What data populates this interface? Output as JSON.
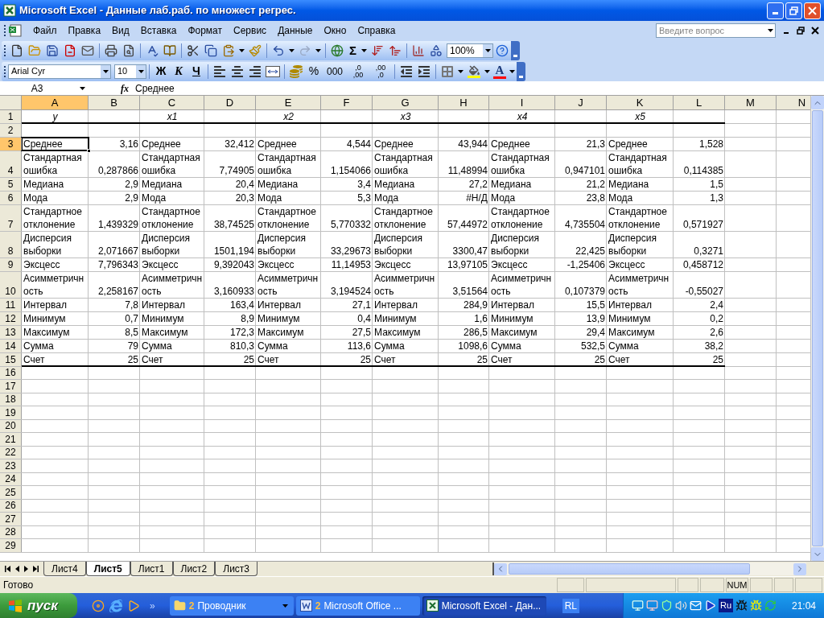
{
  "window": {
    "title": "Microsoft Excel - Данные лаб.раб. по множест регрес."
  },
  "menu": [
    "Файл",
    "Правка",
    "Вид",
    "Вставка",
    "Формат",
    "Сервис",
    "Данные",
    "Окно",
    "Справка"
  ],
  "help_search": {
    "placeholder": "Введите вопрос"
  },
  "standard_toolbar": {
    "sum": "Σ",
    "zoom": "100%"
  },
  "format_toolbar": {
    "font": "Arial Cyr",
    "size": "10",
    "bold": "Ж",
    "italic": "К",
    "underline": "Ч",
    "percent": "%",
    "thousands": "000",
    "increase_decimal": {
      "top": ",0",
      "bottom": ",00"
    },
    "decrease_decimal": {
      "top": ",00",
      "bottom": ",0"
    },
    "font_color": "A"
  },
  "formula_bar": {
    "name_box": "A3",
    "fx": "fx",
    "formula": "Среднее"
  },
  "columns": [
    {
      "label": "A",
      "selected": true
    },
    {
      "label": "B",
      "selected": false
    },
    {
      "label": "C",
      "selected": false
    },
    {
      "label": "D",
      "selected": false
    },
    {
      "label": "E",
      "selected": false
    },
    {
      "label": "F",
      "selected": false
    },
    {
      "label": "G",
      "selected": false
    },
    {
      "label": "H",
      "selected": false
    },
    {
      "label": "I",
      "selected": false
    },
    {
      "label": "J",
      "selected": false
    },
    {
      "label": "K",
      "selected": false
    },
    {
      "label": "L",
      "selected": false
    },
    {
      "label": "M",
      "selected": false
    },
    {
      "label": "N",
      "selected": false
    }
  ],
  "rows": [
    {
      "number": "1",
      "kind": "header",
      "selected": false,
      "labels": [
        "y",
        "x1",
        "x2",
        "x3",
        "x4",
        "x5"
      ]
    },
    {
      "number": "2",
      "kind": "blank",
      "selected": false
    },
    {
      "number": "3",
      "kind": "stats",
      "selected": true,
      "pairs": [
        {
          "label": "Среднее",
          "value": "3,16"
        },
        {
          "label": "Среднее",
          "value": "32,412"
        },
        {
          "label": "Среднее",
          "value": "4,544"
        },
        {
          "label": "Среднее",
          "value": "43,944"
        },
        {
          "label": "Среднее",
          "value": "21,3"
        },
        {
          "label": "Среднее",
          "value": "1,528"
        }
      ]
    },
    {
      "number": "4",
      "kind": "stats",
      "selected": false,
      "pairs": [
        {
          "label": "Стандартная ошибка",
          "value": "0,287866"
        },
        {
          "label": "Стандартная ошибка",
          "value": "7,74905"
        },
        {
          "label": "Стандартная ошибка",
          "value": "1,154066"
        },
        {
          "label": "Стандартная ошибка",
          "value": "11,48994"
        },
        {
          "label": "Стандартная ошибка",
          "value": "0,947101"
        },
        {
          "label": "Стандартная ошибка",
          "value": "0,114385"
        }
      ]
    },
    {
      "number": "5",
      "kind": "stats",
      "selected": false,
      "pairs": [
        {
          "label": "Медиана",
          "value": "2,9"
        },
        {
          "label": "Медиана",
          "value": "20,4"
        },
        {
          "label": "Медиана",
          "value": "3,4"
        },
        {
          "label": "Медиана",
          "value": "27,2"
        },
        {
          "label": "Медиана",
          "value": "21,2"
        },
        {
          "label": "Медиана",
          "value": "1,5"
        }
      ]
    },
    {
      "number": "6",
      "kind": "stats",
      "selected": false,
      "pairs": [
        {
          "label": "Мода",
          "value": "2,9"
        },
        {
          "label": "Мода",
          "value": "20,3"
        },
        {
          "label": "Мода",
          "value": "5,3"
        },
        {
          "label": "Мода",
          "value": "#Н/Д"
        },
        {
          "label": "Мода",
          "value": "23,8"
        },
        {
          "label": "Мода",
          "value": "1,3"
        }
      ]
    },
    {
      "number": "7",
      "kind": "stats",
      "selected": false,
      "pairs": [
        {
          "label": "Стандартное отклонение",
          "value": "1,439329"
        },
        {
          "label": "Стандартное отклонение",
          "value": "38,74525"
        },
        {
          "label": "Стандартное отклонение",
          "value": "5,770332"
        },
        {
          "label": "Стандартное отклонение",
          "value": "57,44972"
        },
        {
          "label": "Стандартное отклонение",
          "value": "4,735504"
        },
        {
          "label": "Стандартное отклонение",
          "value": "0,571927"
        }
      ]
    },
    {
      "number": "8",
      "kind": "stats",
      "selected": false,
      "pairs": [
        {
          "label": "Дисперсия выборки",
          "value": "2,071667"
        },
        {
          "label": "Дисперсия выборки",
          "value": "1501,194"
        },
        {
          "label": "Дисперсия выборки",
          "value": "33,29673"
        },
        {
          "label": "Дисперсия выборки",
          "value": "3300,47"
        },
        {
          "label": "Дисперсия выборки",
          "value": "22,425"
        },
        {
          "label": "Дисперсия выборки",
          "value": "0,3271"
        }
      ]
    },
    {
      "number": "9",
      "kind": "stats",
      "selected": false,
      "pairs": [
        {
          "label": "Эксцесс",
          "value": "7,796343"
        },
        {
          "label": "Эксцесс",
          "value": "9,392043"
        },
        {
          "label": "Эксцесс",
          "value": "11,14953"
        },
        {
          "label": "Эксцесс",
          "value": "13,97105"
        },
        {
          "label": "Эксцесс",
          "value": "-1,25406"
        },
        {
          "label": "Эксцесс",
          "value": "0,458712"
        }
      ]
    },
    {
      "number": "10",
      "kind": "stats",
      "selected": false,
      "pairs": [
        {
          "label": "Асимметричность",
          "value": "2,258167"
        },
        {
          "label": "Асимметричность",
          "value": "3,160933"
        },
        {
          "label": "Асимметричность",
          "value": "3,194524"
        },
        {
          "label": "Асимметричность",
          "value": "3,51564"
        },
        {
          "label": "Асимметричность",
          "value": "0,107379"
        },
        {
          "label": "Асимметричность",
          "value": "-0,55027"
        }
      ]
    },
    {
      "number": "11",
      "kind": "stats",
      "selected": false,
      "pairs": [
        {
          "label": "Интервал",
          "value": "7,8"
        },
        {
          "label": "Интервал",
          "value": "163,4"
        },
        {
          "label": "Интервал",
          "value": "27,1"
        },
        {
          "label": "Интервал",
          "value": "284,9"
        },
        {
          "label": "Интервал",
          "value": "15,5"
        },
        {
          "label": "Интервал",
          "value": "2,4"
        }
      ]
    },
    {
      "number": "12",
      "kind": "stats",
      "selected": false,
      "pairs": [
        {
          "label": "Минимум",
          "value": "0,7"
        },
        {
          "label": "Минимум",
          "value": "8,9"
        },
        {
          "label": "Минимум",
          "value": "0,4"
        },
        {
          "label": "Минимум",
          "value": "1,6"
        },
        {
          "label": "Минимум",
          "value": "13,9"
        },
        {
          "label": "Минимум",
          "value": "0,2"
        }
      ]
    },
    {
      "number": "13",
      "kind": "stats",
      "selected": false,
      "pairs": [
        {
          "label": "Максимум",
          "value": "8,5"
        },
        {
          "label": "Максимум",
          "value": "172,3"
        },
        {
          "label": "Максимум",
          "value": "27,5"
        },
        {
          "label": "Максимум",
          "value": "286,5"
        },
        {
          "label": "Максимум",
          "value": "29,4"
        },
        {
          "label": "Максимум",
          "value": "2,6"
        }
      ]
    },
    {
      "number": "14",
      "kind": "stats",
      "selected": false,
      "pairs": [
        {
          "label": "Сумма",
          "value": "79"
        },
        {
          "label": "Сумма",
          "value": "810,3"
        },
        {
          "label": "Сумма",
          "value": "113,6"
        },
        {
          "label": "Сумма",
          "value": "1098,6"
        },
        {
          "label": "Сумма",
          "value": "532,5"
        },
        {
          "label": "Сумма",
          "value": "38,2"
        }
      ]
    },
    {
      "number": "15",
      "kind": "stats",
      "selected": false,
      "pairs": [
        {
          "label": "Счет",
          "value": "25"
        },
        {
          "label": "Счет",
          "value": "25"
        },
        {
          "label": "Счет",
          "value": "25"
        },
        {
          "label": "Счет",
          "value": "25"
        },
        {
          "label": "Счет",
          "value": "25"
        },
        {
          "label": "Счет",
          "value": "25"
        }
      ]
    },
    {
      "number": "16",
      "kind": "blank",
      "selected": false
    },
    {
      "number": "17",
      "kind": "blank",
      "selected": false
    },
    {
      "number": "18",
      "kind": "blank",
      "selected": false
    },
    {
      "number": "19",
      "kind": "blank",
      "selected": false
    },
    {
      "number": "20",
      "kind": "blank",
      "selected": false
    },
    {
      "number": "21",
      "kind": "blank",
      "selected": false
    },
    {
      "number": "22",
      "kind": "blank",
      "selected": false
    },
    {
      "number": "23",
      "kind": "blank",
      "selected": false
    },
    {
      "number": "24",
      "kind": "blank",
      "selected": false
    },
    {
      "number": "25",
      "kind": "blank",
      "selected": false
    },
    {
      "number": "26",
      "kind": "blank",
      "selected": false
    },
    {
      "number": "27",
      "kind": "blank",
      "selected": false
    },
    {
      "number": "28",
      "kind": "blank",
      "selected": false
    },
    {
      "number": "29",
      "kind": "blank",
      "selected": false
    }
  ],
  "sheet_tabs": [
    {
      "label": "Лист4",
      "selected": false
    },
    {
      "label": "Лист5",
      "selected": true
    },
    {
      "label": "Лист1",
      "selected": false
    },
    {
      "label": "Лист2",
      "selected": false
    },
    {
      "label": "Лист3",
      "selected": false
    }
  ],
  "status_bar": {
    "status": "Готово",
    "indicator": "NUM"
  },
  "taskbar": {
    "start": "пуск",
    "more": "»",
    "tasks": [
      {
        "kind": "folder",
        "count": "2",
        "label": "Проводник",
        "selected": false
      },
      {
        "kind": "word",
        "count": "2",
        "label": "Microsoft Office ...",
        "selected": false
      },
      {
        "kind": "excel",
        "label": "Microsoft Excel - Дан...",
        "selected": true
      }
    ],
    "language": "RL",
    "tray_text": "Ru",
    "clock": "21:04"
  }
}
